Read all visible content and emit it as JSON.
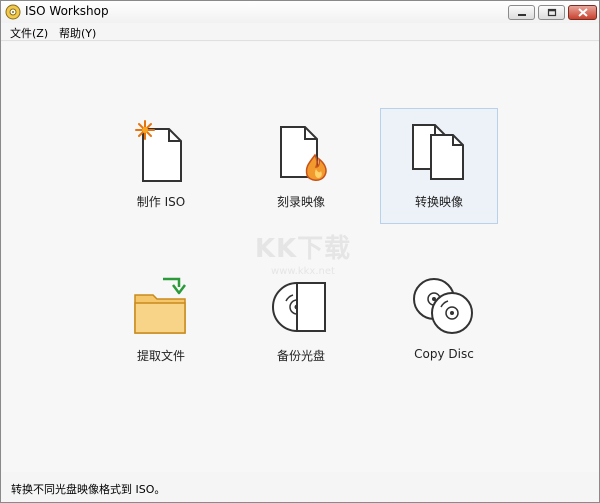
{
  "window": {
    "title": "ISO Workshop"
  },
  "menu": {
    "file": "文件(Z)",
    "help": "帮助(Y)"
  },
  "tiles": [
    {
      "label": "制作 ISO",
      "icon": "create-iso-icon"
    },
    {
      "label": "刻录映像",
      "icon": "burn-image-icon"
    },
    {
      "label": "转换映像",
      "icon": "convert-image-icon",
      "selected": true
    },
    {
      "label": "提取文件",
      "icon": "extract-files-icon"
    },
    {
      "label": "备份光盘",
      "icon": "backup-disc-icon"
    },
    {
      "label": "Copy Disc",
      "icon": "copy-disc-icon"
    }
  ],
  "watermark": {
    "text": "KK下载",
    "url": "www.kkx.net"
  },
  "status": {
    "text": "转换不同光盘映像格式到 ISO。"
  },
  "colors": {
    "accent": "#e8730c",
    "selected_bg": "#edf2f8",
    "selected_border": "#b9d1ea",
    "folder": "#f5c76a",
    "arrow": "#2a9a3a"
  }
}
